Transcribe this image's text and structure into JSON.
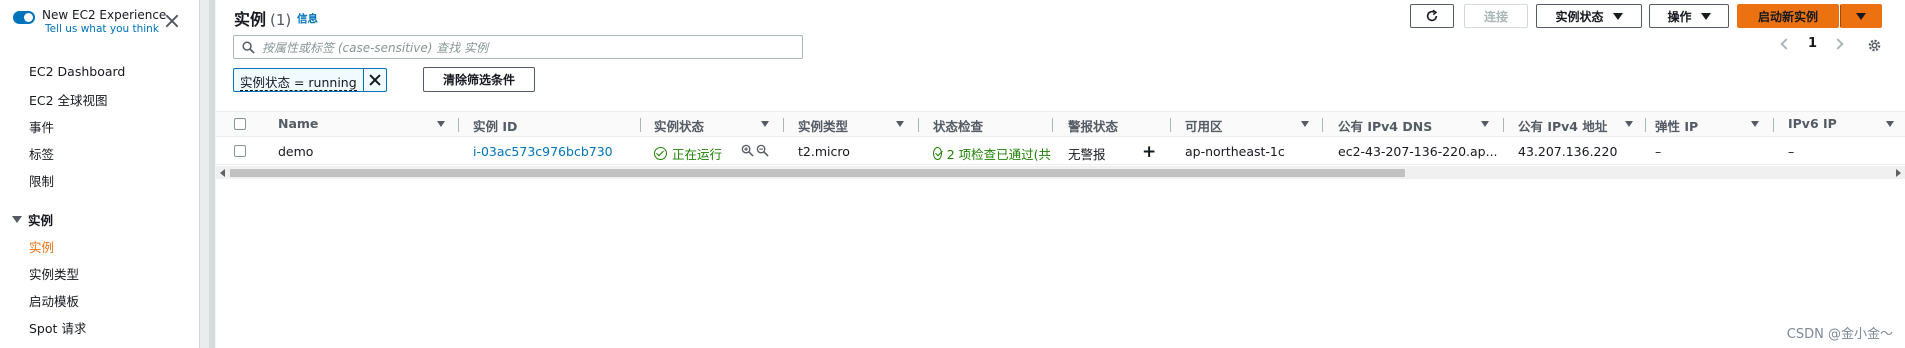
{
  "sidebar": {
    "experience_title": "New EC2 Experience",
    "experience_sub": "Tell us what you think",
    "items": [
      {
        "label": "EC2 Dashboard"
      },
      {
        "label": "EC2 全球视图"
      },
      {
        "label": "事件"
      },
      {
        "label": "标签"
      },
      {
        "label": "限制"
      }
    ],
    "section": "实例",
    "section_items": [
      {
        "label": "实例",
        "active": true
      },
      {
        "label": "实例类型"
      },
      {
        "label": "启动模板"
      },
      {
        "label": "Spot 请求"
      }
    ]
  },
  "header": {
    "title": "实例",
    "count": "(1)",
    "info": "信息",
    "connect": "连接",
    "instance_state": "实例状态",
    "actions": "操作",
    "launch": "启动新实例"
  },
  "search": {
    "placeholder": "按属性或标签 (case-sensitive) 查找 实例"
  },
  "filter": {
    "chip": "实例状态 = running",
    "clear": "清除筛选条件"
  },
  "pagination": {
    "page": "1"
  },
  "table": {
    "columns": [
      "Name",
      "实例 ID",
      "实例状态",
      "实例类型",
      "状态检查",
      "警报状态",
      "可用区",
      "公有 IPv4 DNS",
      "公有 IPv4 地址",
      "弹性 IP",
      "IPv6 IP"
    ],
    "rows": [
      {
        "name": "demo",
        "id": "i-03ac573c976bcb730",
        "state": "正在运行",
        "type": "t2.micro",
        "check": "2 项检查已通过(共",
        "alarm": "无警报",
        "az": "ap-northeast-1c",
        "dns": "ec2-43-207-136-220.ap...",
        "ip": "43.207.136.220",
        "eip": "–",
        "ipv6": "–"
      }
    ]
  },
  "watermark": "CSDN @金小金～",
  "colors": {
    "accent": "#0073bb",
    "primary": "#ec7211",
    "success": "#1d8102"
  }
}
